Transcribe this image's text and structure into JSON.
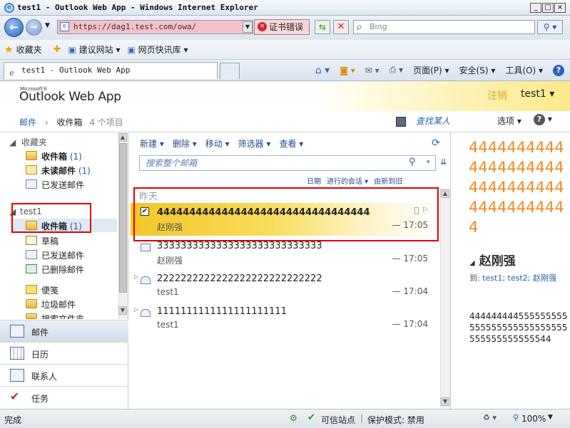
{
  "window": {
    "title": "test1 - Outlook Web App - Windows Internet Explorer"
  },
  "browser": {
    "address": "https://dag1.test.com/owa/",
    "cert_error": "证书错误",
    "search_placeholder": "Bing",
    "favorites": [
      "收藏夹",
      "建议网站",
      "网页快讯库"
    ],
    "tab_title": "test1 - Outlook Web App",
    "commands": [
      "页面(P)",
      "安全(S)",
      "工具(O)"
    ]
  },
  "owa": {
    "logo_small": "Microsoft®",
    "logo": "Outlook Web App",
    "signout": "注销",
    "user": "test1",
    "crumb": {
      "mail": "邮件",
      "inbox": "收件箱",
      "count": "4 个项目"
    },
    "find_someone": "查找某人",
    "options": "选项"
  },
  "folders": {
    "favorites_header": "收藏夹",
    "favorites": [
      {
        "label": "收件箱",
        "count": "(1)"
      },
      {
        "label": "未读邮件",
        "count": "(1)"
      },
      {
        "label": "已发送邮件",
        "count": ""
      }
    ],
    "mailbox_header": "test1",
    "mailbox": [
      {
        "label": "收件箱",
        "count": "(1)"
      },
      {
        "label": "草稿",
        "count": ""
      },
      {
        "label": "已发送邮件",
        "count": ""
      },
      {
        "label": "已删除邮件",
        "count": ""
      },
      {
        "label": "便笺",
        "count": ""
      },
      {
        "label": "垃圾邮件",
        "count": ""
      },
      {
        "label": "搜索文件夹",
        "count": ""
      }
    ]
  },
  "nav": [
    {
      "label": "邮件"
    },
    {
      "label": "日历"
    },
    {
      "label": "联系人"
    },
    {
      "label": "任务"
    }
  ],
  "list": {
    "toolbar": [
      "新建",
      "删除",
      "移动",
      "筛选器",
      "查看"
    ],
    "search_placeholder": "搜索整个邮箱",
    "sort": {
      "by": "日期",
      "mode": "进行的会话",
      "order": "由新到旧"
    },
    "group": "昨天",
    "messages": [
      {
        "subject": "444444444444444444444444444444444...",
        "from": "赵刚强",
        "time": "— 17:05",
        "unread": true
      },
      {
        "subject": "3333333333333333333333333333",
        "from": "赵刚强",
        "time": "— 17:05",
        "unread": false
      },
      {
        "subject": "2222222222222222222222222222",
        "from": "test1",
        "time": "— 17:04",
        "unread": false
      },
      {
        "subject": "1111111111111111111111",
        "from": "test1",
        "time": "— 17:04",
        "unread": false
      }
    ]
  },
  "reading": {
    "subject": "44444444444444444444444444444444444444444",
    "sender": "赵刚强",
    "to_label": "到:",
    "recipients": "test1; test2; 赵刚强",
    "body": "444444444555555555555555555555555555555555555555544"
  },
  "status": {
    "left": "完成",
    "zone": "可信站点",
    "protected": "保护模式: 禁用",
    "zoom": "100%"
  }
}
